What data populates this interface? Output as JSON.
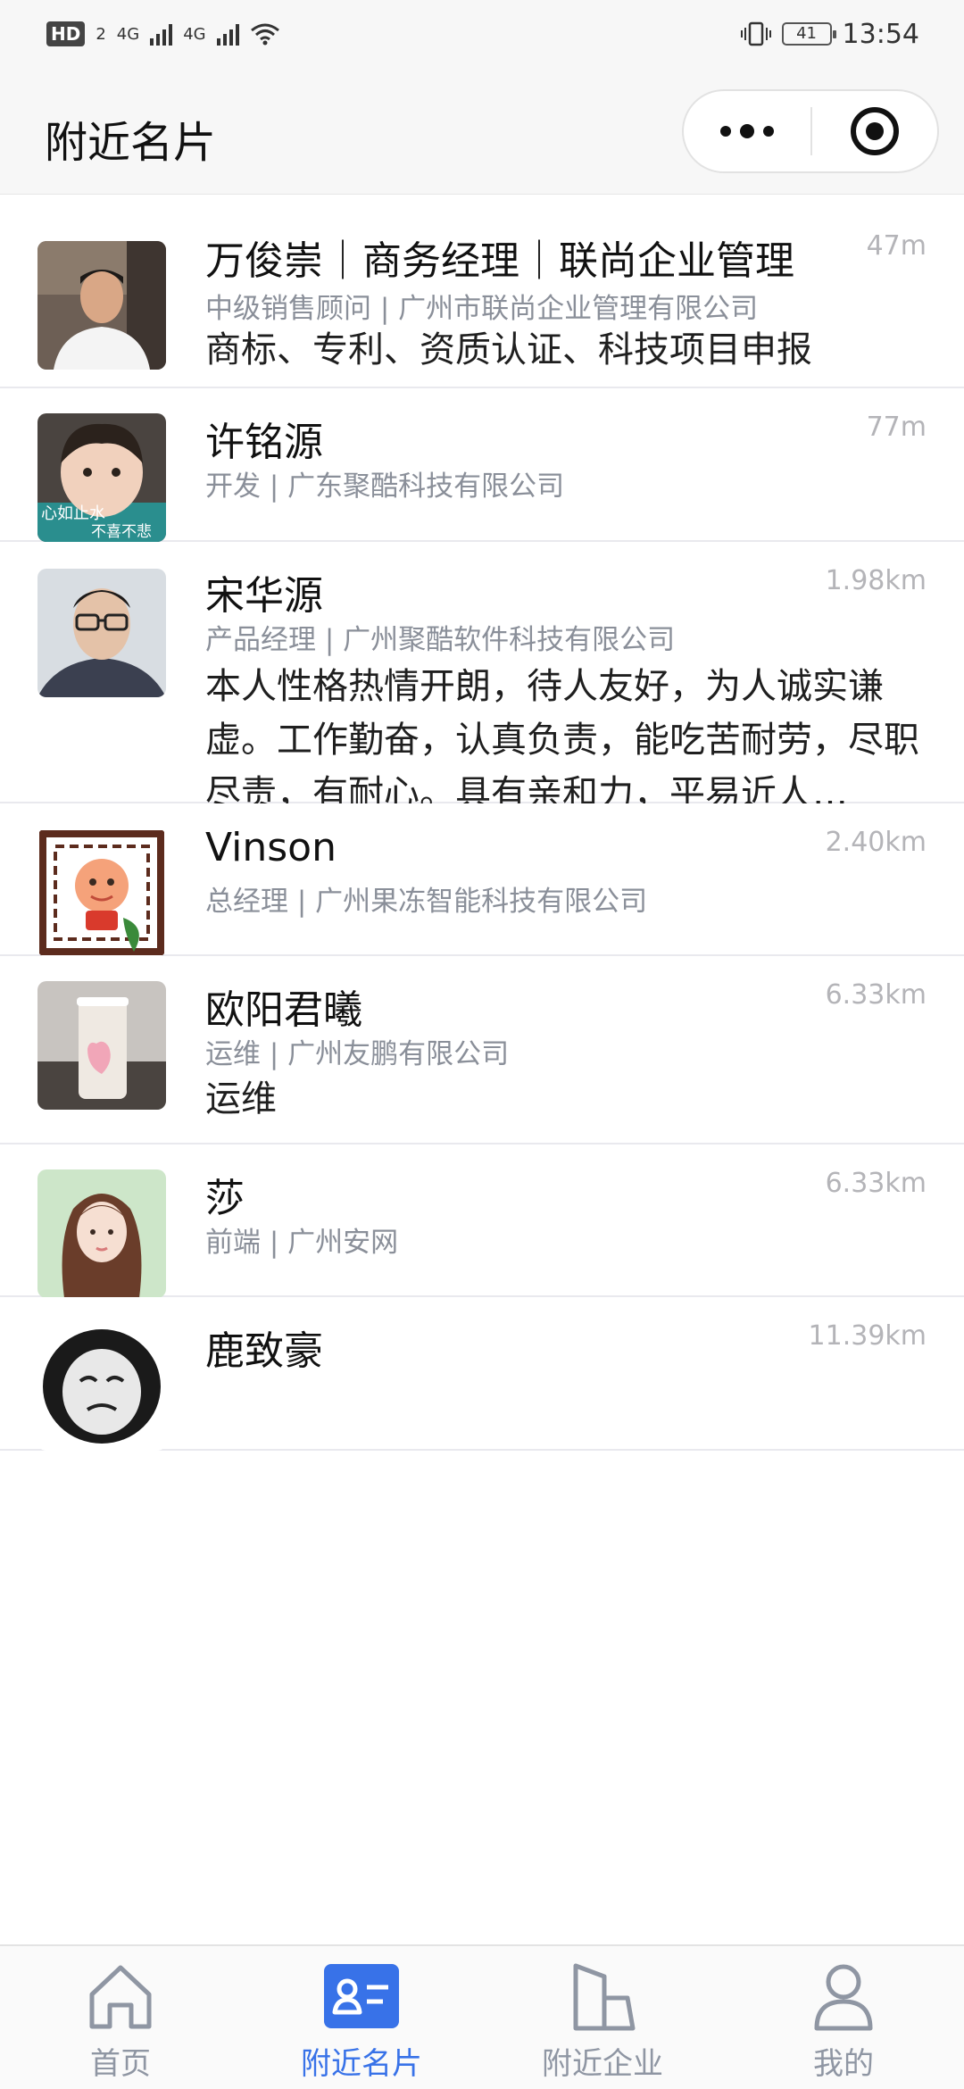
{
  "status_bar": {
    "left_badge": "HD",
    "left_badge_sub": "2",
    "network_1": "4G",
    "network_2": "4G",
    "battery": "41",
    "time": "13:54"
  },
  "header": {
    "title": "附近名片",
    "more_icon": "more-dots-icon",
    "target_icon": "target-icon"
  },
  "cards": [
    {
      "name": "万俊崇｜商务经理｜联尚企业管理",
      "distance": "47m",
      "subtitle": "中级销售顾问 | 广州市联尚企业管理有限公司",
      "description": "商标、专利、资质认证、科技项目申报"
    },
    {
      "name": "许铭源",
      "distance": "77m",
      "subtitle": "开发 | 广东聚酷科技有限公司",
      "avatar_caption_1": "心如止水",
      "avatar_caption_2": "不喜不悲"
    },
    {
      "name": "宋华源",
      "distance": "1.98km",
      "subtitle": "产品经理 | 广州聚酷软件科技有限公司",
      "description": "本人性格热情开朗，待人友好，为人诚实谦虚。工作勤奋，认真负责，能吃苦耐劳，尽职尽责，有耐心。具有亲和力，平易近人…"
    },
    {
      "name": "Vinson",
      "distance": "2.40km",
      "subtitle": "总经理 | 广州果冻智能科技有限公司"
    },
    {
      "name": "欧阳君曦",
      "distance": "6.33km",
      "subtitle": "运维 | 广州友鹏有限公司",
      "description": "运维"
    },
    {
      "name": "莎",
      "distance": "6.33km",
      "subtitle": "前端 | 广州安网"
    },
    {
      "name": "鹿致豪",
      "distance": "11.39km"
    }
  ],
  "tabs": [
    {
      "label": "首页",
      "icon": "home-icon",
      "active": false
    },
    {
      "label": "附近名片",
      "icon": "card-icon",
      "active": true
    },
    {
      "label": "附近企业",
      "icon": "building-icon",
      "active": false
    },
    {
      "label": "我的",
      "icon": "user-icon",
      "active": false
    }
  ],
  "colors": {
    "accent": "#3872e8",
    "muted_text": "#8a8f99",
    "distance_text": "#b4b4b8"
  }
}
